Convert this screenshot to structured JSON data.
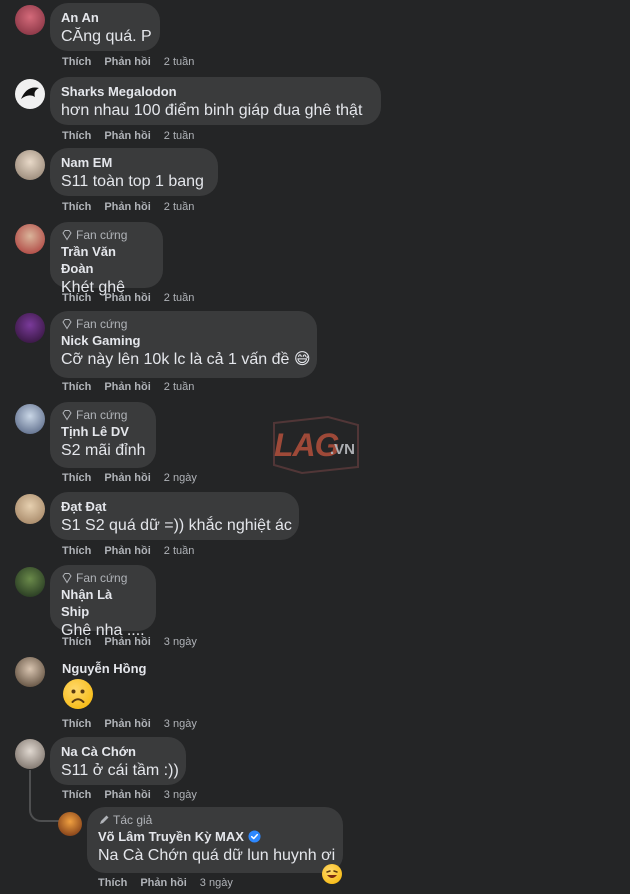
{
  "comments": [
    {
      "badge": "",
      "name": "An An",
      "text": "CĂng quá. P",
      "like": "Thích",
      "reply": "Phản hồi",
      "time": "2 tuần"
    },
    {
      "badge": "",
      "name": "Sharks Megalodon",
      "text": "hơn nhau 100 điểm binh giáp đua ghê thật",
      "like": "Thích",
      "reply": "Phản hồi",
      "time": "2 tuần"
    },
    {
      "badge": "",
      "name": "Nam EM",
      "text": "S11 toàn top 1 bang",
      "like": "Thích",
      "reply": "Phản hồi",
      "time": "2 tuần"
    },
    {
      "badge": "Fan cứng",
      "name": "Trần Văn Đoàn",
      "text": "Khét ghê",
      "like": "Thích",
      "reply": "Phản hồi",
      "time": "2 tuần"
    },
    {
      "badge": "Fan cứng",
      "name": "Nick Gaming",
      "text": "Cỡ này lên 10k lc là cả 1 vấn đề 😅",
      "like": "Thích",
      "reply": "Phản hồi",
      "time": "2 tuần"
    },
    {
      "badge": "Fan cứng",
      "name": "Tịnh Lê DV",
      "text": "S2 mãi đỉnh",
      "like": "Thích",
      "reply": "Phản hồi",
      "time": "2 ngày"
    },
    {
      "badge": "",
      "name": "Đạt Đạt",
      "text": "S1 S2 quá dữ =)) khắc nghiệt ác",
      "like": "Thích",
      "reply": "Phản hồi",
      "time": "2 tuần"
    },
    {
      "badge": "Fan cứng",
      "name": "Nhận Là Ship",
      "text": "Ghê nha ....",
      "like": "Thích",
      "reply": "Phản hồi",
      "time": "3 ngày"
    },
    {
      "badge": "",
      "name": "Nguyễn Hồng",
      "text": "",
      "like": "Thích",
      "reply": "Phản hồi",
      "time": "3 ngày"
    },
    {
      "badge": "",
      "name": "Na Cà Chớn",
      "text": "S11 ở cái tầm :))",
      "like": "Thích",
      "reply": "Phản hồi",
      "time": "3 ngày"
    }
  ],
  "reply": {
    "badge": "Tác giả",
    "name": "Võ Lâm Truyền Kỳ MAX",
    "text": "Na Cà Chớn quá dữ lun huynh ơi",
    "like": "Thích",
    "reply": "Phản hồi",
    "time": "3 ngày"
  },
  "watermark": {
    "brand": "LAG",
    "suffix": ".VN"
  },
  "colors": {
    "background": "#242526",
    "bubble": "#3a3b3c",
    "text": "#e4e6eb",
    "muted": "#b0b3b8",
    "verified": "#2d88ff"
  }
}
